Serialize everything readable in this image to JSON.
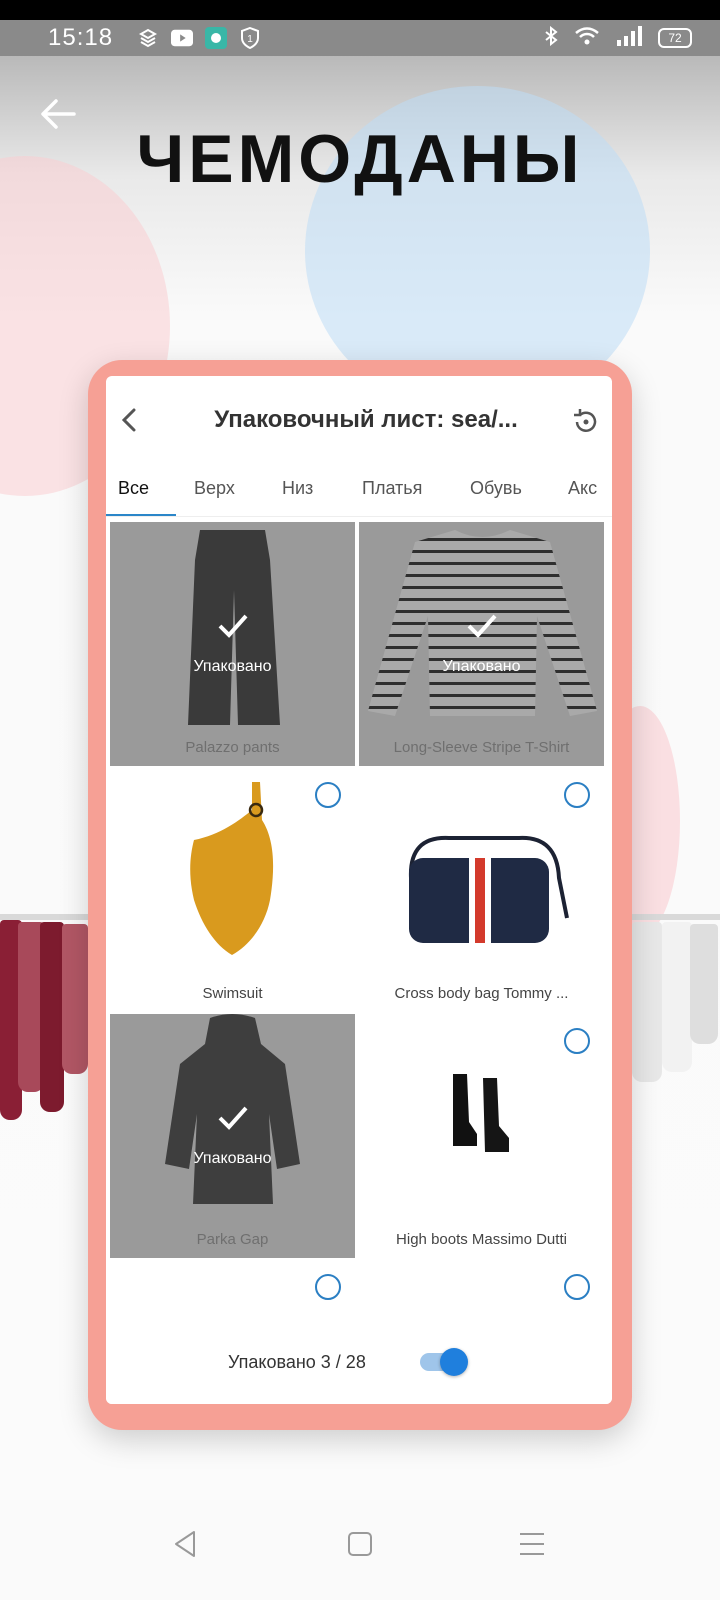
{
  "status_bar": {
    "time": "15:18",
    "battery": "72"
  },
  "hero": {
    "title": "ЧЕМОДАНЫ"
  },
  "app": {
    "title": "Упаковочный лист: sea/...",
    "tabs": [
      "Все",
      "Верх",
      "Низ",
      "Платья",
      "Обувь",
      "Акс"
    ],
    "active_tab": "Все",
    "items": [
      {
        "name": "Palazzo pants",
        "packed": true
      },
      {
        "name": "Long-Sleeve Stripe T-Shirt",
        "packed": true
      },
      {
        "name": "Swimsuit",
        "packed": false
      },
      {
        "name": "Cross  body bag Tommy ...",
        "packed": false
      },
      {
        "name": "Parka Gap",
        "packed": true
      },
      {
        "name": "High boots Massimo Dutti",
        "packed": false
      }
    ],
    "packed_label": "Упаковано",
    "footer": {
      "packed_count_text": "Упаковано 3 / 28",
      "toggle_on": true
    },
    "accent_color": "#2b7fc3",
    "frame_color": "#f6a095"
  }
}
